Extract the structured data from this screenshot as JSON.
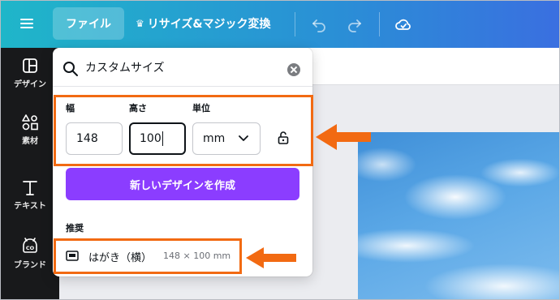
{
  "topbar": {
    "file_label": "ファイル",
    "resize_label": "リサイズ&マジック変換",
    "icons": [
      "menu-icon",
      "crown-icon",
      "undo-icon",
      "redo-icon",
      "cloud-save-icon"
    ]
  },
  "sidebar": {
    "items": [
      {
        "label": "デザイン",
        "icon": "design-icon"
      },
      {
        "label": "素材",
        "icon": "elements-icon"
      },
      {
        "label": "テキスト",
        "icon": "text-icon"
      },
      {
        "label": "ブランド",
        "icon": "brand-icon"
      }
    ]
  },
  "size_panel": {
    "search_value": "カスタムサイズ",
    "width_label": "幅",
    "height_label": "高さ",
    "unit_label": "単位",
    "width_value": "148",
    "height_value": "100",
    "unit_value": "mm",
    "create_button": "新しいデザインを作成",
    "recommend_label": "推奨",
    "recommendations": [
      {
        "name": "はがき（横）",
        "dims": "148 × 100 mm"
      }
    ]
  },
  "colors": {
    "accent_purple": "#8b3dff",
    "highlight_orange": "#f26a12",
    "sidebar_bg": "#18191b",
    "topbar_gradient_start": "#1fb6c9",
    "topbar_gradient_end": "#3a6fe0"
  }
}
